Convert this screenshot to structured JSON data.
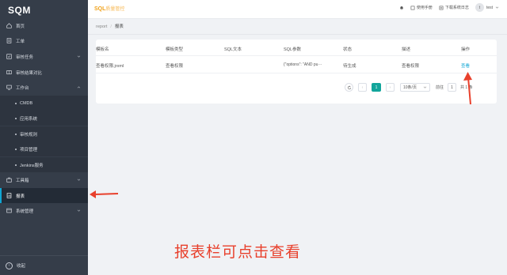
{
  "brand": {
    "logo": "SQM",
    "title": "SQL",
    "subtitle": "质量管控"
  },
  "sidebar": {
    "items": [
      {
        "label": "首页",
        "icon": "home-icon"
      },
      {
        "label": "工单",
        "icon": "ticket-icon"
      },
      {
        "label": "审核任务",
        "icon": "task-icon"
      },
      {
        "label": "审核结果对比",
        "icon": "compare-icon"
      },
      {
        "label": "工作台",
        "icon": "workbench-icon"
      },
      {
        "label": "CMDB"
      },
      {
        "label": "应用系统"
      },
      {
        "label": "审核规则"
      },
      {
        "label": "项目管理"
      },
      {
        "label": "Jenkins服务"
      },
      {
        "label": "工具箱",
        "icon": "toolbox-icon"
      },
      {
        "label": "报表",
        "icon": "report-icon"
      },
      {
        "label": "系统管理",
        "icon": "settings-icon"
      }
    ],
    "collapse_label": "收起"
  },
  "header": {
    "manual_label": "使用手册",
    "download_label": "下载系统日志",
    "avatar_letter": "t",
    "username": "test"
  },
  "breadcrumb": {
    "root": "report",
    "separator": "/",
    "current": "报表"
  },
  "table": {
    "headers": [
      "模板名",
      "模板类型",
      "SQL文本",
      "SQL参数",
      "状态",
      "描述",
      "操作"
    ],
    "rows": [
      {
        "name": "查看权限.jrxml",
        "type": "查看权限",
        "sql_text": "",
        "sql_params": "{\"options\": \"AND pu···",
        "status": "待生成",
        "desc": "查看权限",
        "action": "查看"
      }
    ]
  },
  "pagination": {
    "current_page": "1",
    "page_size": "10条/页",
    "goto_label": "前往",
    "goto_value": "1",
    "total_label": "共 1 条"
  },
  "annotation": {
    "text": "报表栏可点击查看",
    "color": "#e8402c"
  }
}
